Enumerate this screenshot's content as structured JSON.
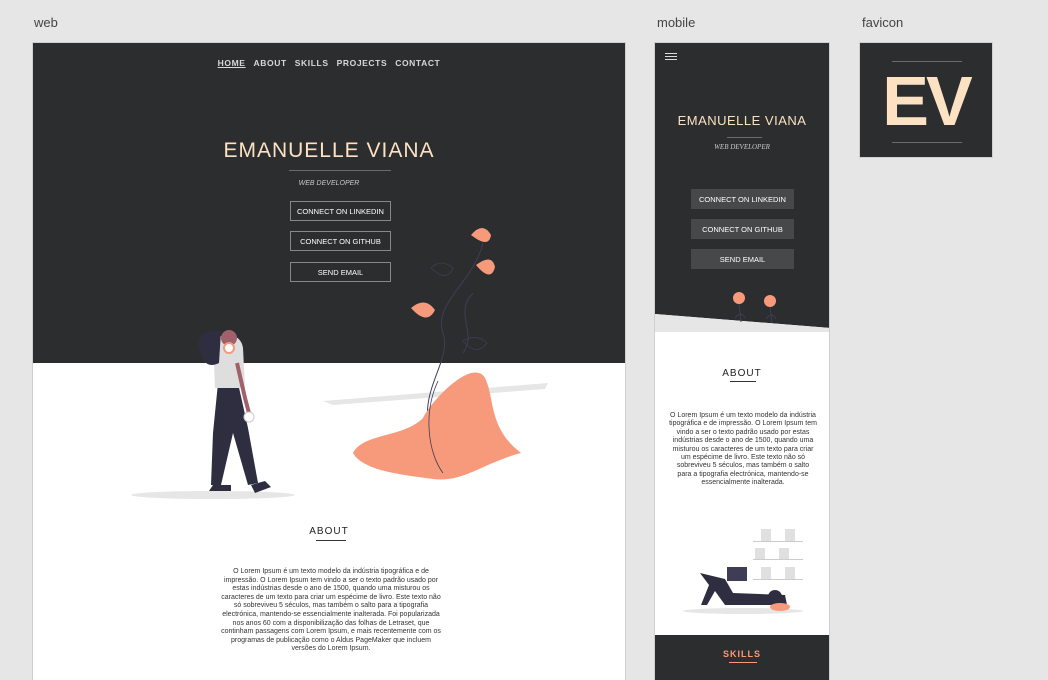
{
  "labels": {
    "web": "web",
    "mobile": "mobile",
    "favicon": "favicon"
  },
  "web": {
    "nav": [
      "HOME",
      "ABOUT",
      "SKILLS",
      "PROJECTS",
      "CONTACT"
    ],
    "name": "EMANUELLE VIANA",
    "role": "WEB DEVELOPER",
    "buttons": [
      "CONNECT ON LINKEDIN",
      "CONNECT ON GITHUB",
      "SEND EMAIL"
    ],
    "about_title": "ABOUT",
    "about_text": "O Lorem Ipsum é um texto modelo da indústria tipográfica e de impressão. O Lorem Ipsum tem vindo a ser o texto padrão usado por estas indústrias desde o ano de 1500, quando uma misturou os caracteres de um texto para criar um espécime de livro. Este texto não só sobreviveu 5 séculos, mas também o salto para a tipografia electrónica, mantendo-se essencialmente inalterada. Foi popularizada nos anos 60 com a disponibilização das folhas de Letraset, que continham passagens com Lorem Ipsum, e mais recentemente com os programas de publicação como o Aldus PageMaker que incluem versões do Lorem Ipsum."
  },
  "mobile": {
    "name": "EMANUELLE VIANA",
    "role": "WEB DEVELOPER",
    "buttons": [
      "CONNECT ON LINKEDIN",
      "CONNECT ON GITHUB",
      "SEND EMAIL"
    ],
    "about_title": "ABOUT",
    "about_text": "O Lorem Ipsum é um texto modelo da indústria tipográfica e de impressão. O Lorem Ipsum tem vindo a ser o texto padrão usado por estas indústrias desde o ano de 1500, quando uma misturou os caracteres de um texto para criar um espécime de livro. Este texto não só sobreviveu 5 séculos, mas também o salto para a tipografia electrónica, mantendo-se essencialmente inalterada.",
    "skills_title": "SKILLS"
  },
  "favicon": {
    "text": "EV"
  },
  "colors": {
    "dark": "#2b2d2f",
    "cream": "#fce2c2",
    "coral": "#f79a7b",
    "purple": "#2f2e41"
  }
}
